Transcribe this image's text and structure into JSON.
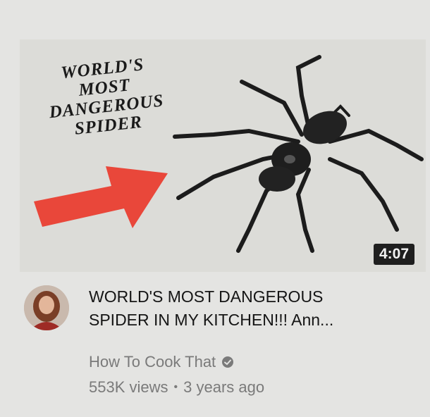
{
  "video": {
    "thumbnail": {
      "overlay_text": [
        "WORLD'S",
        "MOST",
        "DANGEROUS",
        "SPIDER"
      ],
      "duration": "4:07",
      "arrow_color": "#e9473a"
    },
    "title_line1": "WORLD'S MOST DANGEROUS",
    "title_line2": "SPIDER IN MY KITCHEN!!! Ann...",
    "channel": "How To Cook That",
    "channel_verified_icon": "check-circle-icon",
    "views": "553K views",
    "separator": "•",
    "age": "3 years ago"
  }
}
